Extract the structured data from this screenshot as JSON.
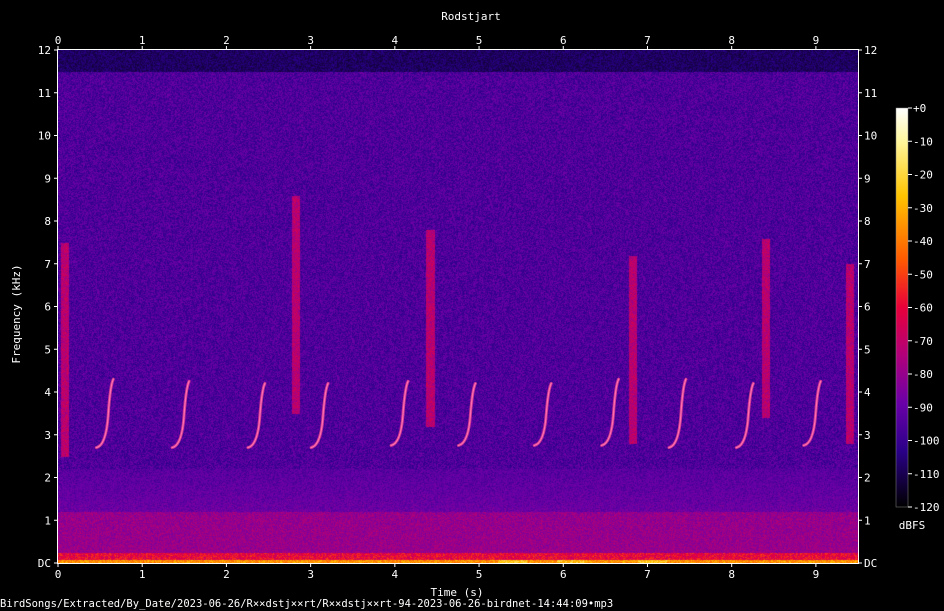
{
  "chart_data": {
    "type": "heatmap",
    "title": "Rodstjart",
    "xlabel": "Time (s)",
    "ylabel": "Frequency (kHz)",
    "xlim": [
      0,
      9.5
    ],
    "ylim": [
      0,
      12
    ],
    "x_ticks": [
      "0",
      "1",
      "2",
      "3",
      "4",
      "5",
      "6",
      "7",
      "8",
      "9"
    ],
    "y_ticks": [
      "DC",
      "1",
      "2",
      "3",
      "4",
      "5",
      "6",
      "7",
      "8",
      "9",
      "10",
      "11",
      "12"
    ],
    "colorbar": {
      "label": "dBFS",
      "ticks": [
        "+0",
        "-10",
        "-20",
        "-30",
        "-40",
        "-50",
        "-60",
        "-70",
        "-80",
        "-90",
        "-100",
        "-110",
        "-120"
      ],
      "range": [
        -120,
        0
      ]
    },
    "background_level_dbfs": -95,
    "noise_ceiling_khz": 11.5,
    "low_frequency_band": {
      "top_khz": 1.2,
      "level_dbfs": -80
    },
    "dc_band": {
      "level_dbfs": -35,
      "hot_spots_s": [
        5.4,
        6.1,
        7.05
      ]
    },
    "calls": [
      {
        "t": 0.55,
        "f_low_khz": 2.7,
        "f_high_khz": 4.3
      },
      {
        "t": 1.45,
        "f_low_khz": 2.7,
        "f_high_khz": 4.25
      },
      {
        "t": 2.35,
        "f_low_khz": 2.7,
        "f_high_khz": 4.2
      },
      {
        "t": 3.1,
        "f_low_khz": 2.7,
        "f_high_khz": 4.2
      },
      {
        "t": 4.05,
        "f_low_khz": 2.75,
        "f_high_khz": 4.25
      },
      {
        "t": 4.85,
        "f_low_khz": 2.75,
        "f_high_khz": 4.2
      },
      {
        "t": 5.75,
        "f_low_khz": 2.75,
        "f_high_khz": 4.2
      },
      {
        "t": 6.55,
        "f_low_khz": 2.75,
        "f_high_khz": 4.3
      },
      {
        "t": 7.35,
        "f_low_khz": 2.7,
        "f_high_khz": 4.3
      },
      {
        "t": 8.15,
        "f_low_khz": 2.7,
        "f_high_khz": 4.2
      },
      {
        "t": 8.95,
        "f_low_khz": 2.75,
        "f_high_khz": 4.25
      }
    ],
    "broadband_streaks": [
      {
        "t": 0.08,
        "f_low_khz": 2.5,
        "f_high_khz": 7.5
      },
      {
        "t": 2.82,
        "f_low_khz": 3.5,
        "f_high_khz": 8.6
      },
      {
        "t": 4.42,
        "f_low_khz": 3.2,
        "f_high_khz": 7.8
      },
      {
        "t": 6.82,
        "f_low_khz": 2.8,
        "f_high_khz": 7.2
      },
      {
        "t": 8.4,
        "f_low_khz": 3.4,
        "f_high_khz": 7.6
      },
      {
        "t": 9.4,
        "f_low_khz": 2.8,
        "f_high_khz": 7.0
      }
    ]
  },
  "footer": {
    "path": "BirdSongs/Extracted/By_Date/2023-06-26/R××dstj××rt/R××dstj××rt-94-2023-06-26-birdnet-14:44:09•mp3"
  }
}
